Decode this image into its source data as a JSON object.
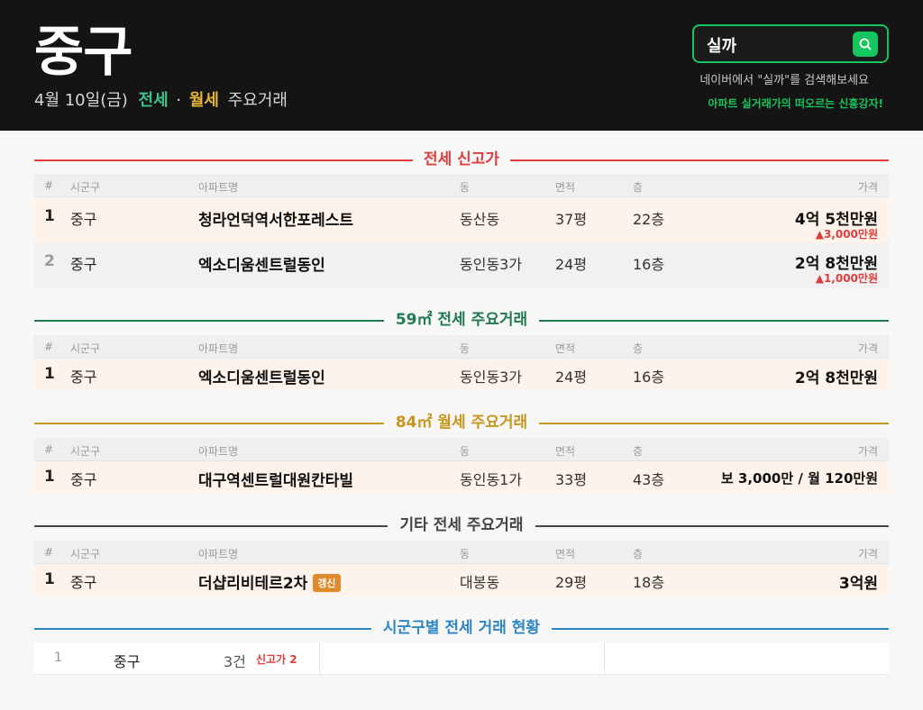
{
  "header": {
    "district": "중구",
    "date": "4월 10일(금)",
    "kw_jeonse": "전세",
    "dot": "·",
    "kw_wolse": "월세",
    "tail": "주요거래",
    "search_query": "실까",
    "search_hint": "네이버에서 \"실까\"를 검색해보세요",
    "promo": "아파트 실거래가의 떠오르는 신흥강자!"
  },
  "colors": {
    "header_bg": "#141414",
    "search_green": "#14c65d",
    "red": "#e03c3c",
    "green_section": "#1f7a4f",
    "gold_section": "#c7961e",
    "gray_section": "#444444",
    "blue_section": "#2f86c4"
  },
  "columns": {
    "num": "#",
    "sigungu": "시군구",
    "apt": "아파트명",
    "dong": "동",
    "area": "면적",
    "floor": "층",
    "price": "가격"
  },
  "sections": {
    "high": {
      "title": "전세 신고가",
      "rows": [
        {
          "num": "1",
          "sigungu": "중구",
          "apt": "청라언덕역서한포레스트",
          "dong": "동산동",
          "area": "37평",
          "floor": "22층",
          "price": "4억 5천만원",
          "change": "▲3,000만원"
        },
        {
          "num": "2",
          "sigungu": "중구",
          "apt": "엑소디움센트럴동인",
          "dong": "동인동3가",
          "area": "24평",
          "floor": "16층",
          "price": "2억 8천만원",
          "change": "▲1,000만원"
        }
      ]
    },
    "s59": {
      "title": "59㎡ 전세 주요거래",
      "rows": [
        {
          "num": "1",
          "sigungu": "중구",
          "apt": "엑소디움센트럴동인",
          "dong": "동인동3가",
          "area": "24평",
          "floor": "16층",
          "price": "2억 8천만원"
        }
      ]
    },
    "s84": {
      "title": "84㎡ 월세 주요거래",
      "rows": [
        {
          "num": "1",
          "sigungu": "중구",
          "apt": "대구역센트럴대원칸타빌",
          "dong": "동인동1가",
          "area": "33평",
          "floor": "43층",
          "price": "보 3,000만 / 월 120만원"
        }
      ]
    },
    "etc": {
      "title": "기타 전세 주요거래",
      "rows": [
        {
          "num": "1",
          "sigungu": "중구",
          "apt": "더샵리비테르2차",
          "badge": "갱신",
          "dong": "대봉동",
          "area": "29평",
          "floor": "18층",
          "price": "3억원"
        }
      ]
    },
    "summary": {
      "title": "시군구별 전세 거래 현황",
      "rows": [
        {
          "num": "1",
          "sigungu": "중구",
          "count": "3건",
          "record": "신고가 2"
        }
      ]
    }
  }
}
